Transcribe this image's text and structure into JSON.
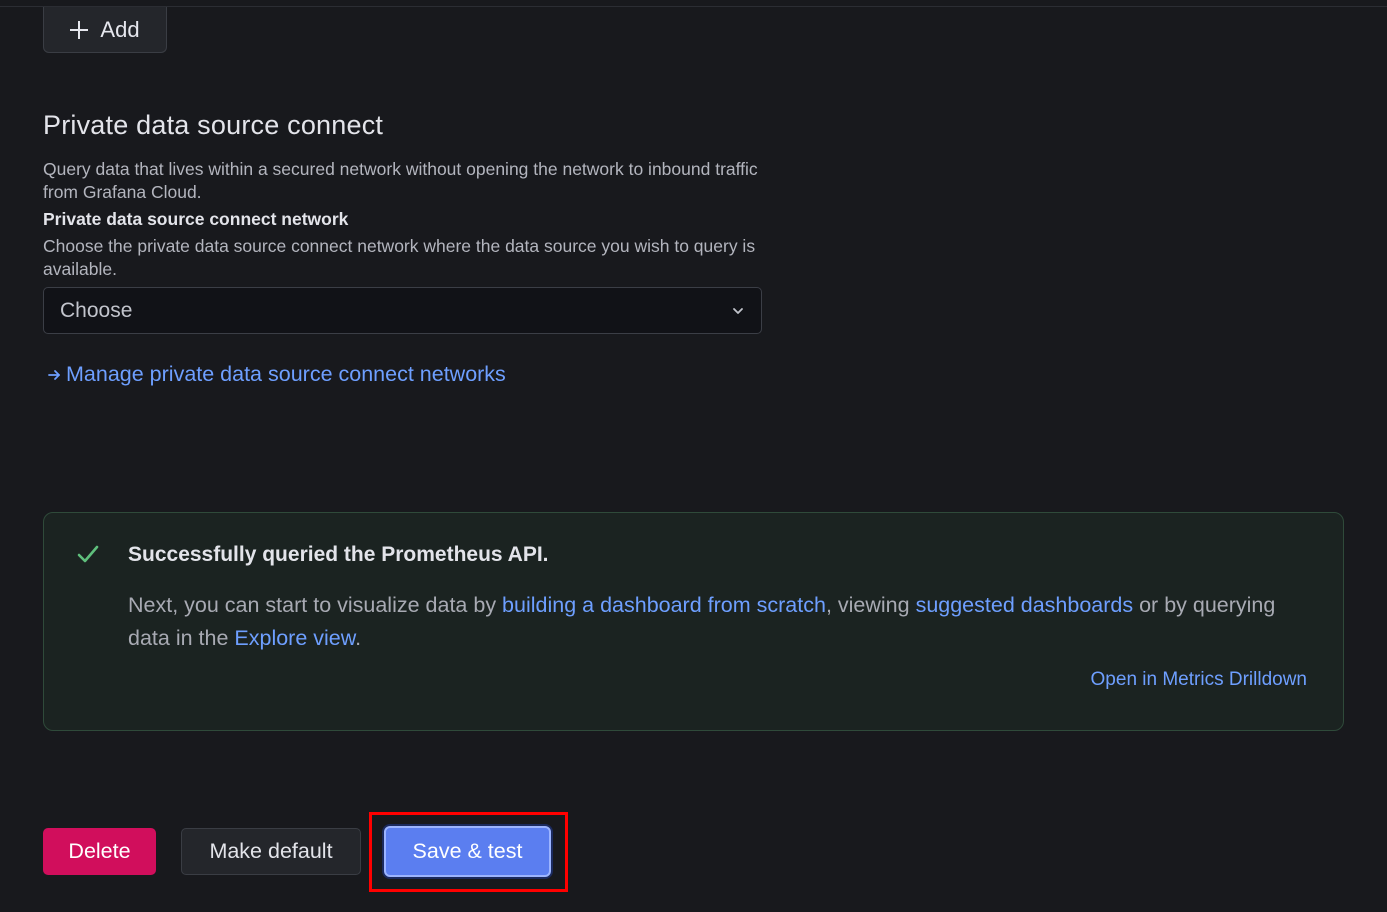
{
  "toolbar": {
    "add_label": "Add",
    "add_icon": "plus-icon"
  },
  "pdc": {
    "title": "Private data source connect",
    "description": "Query data that lives within a secured network without opening the network to inbound traffic from Grafana Cloud.",
    "network_label": "Private data source connect network",
    "network_description": "Choose the private data source connect network where the data source you wish to query is available.",
    "network_select": {
      "value": "Choose",
      "icon": "chevron-down-icon"
    },
    "manage_link": "Manage private data source connect networks"
  },
  "alert": {
    "status": "success",
    "title": "Successfully queried the Prometheus API.",
    "body_part1": "Next, you can start to visualize data by ",
    "link_dashboard": "building a dashboard from scratch",
    "body_part2": ", viewing ",
    "link_suggested": "suggested dashboards",
    "body_part3": " or by querying data in the ",
    "link_explore": "Explore view",
    "body_part4": ".",
    "metrics_link": "Open in Metrics Drilldown"
  },
  "actions": {
    "delete": "Delete",
    "make_default": "Make default",
    "save_test": "Save & test"
  },
  "colors": {
    "background": "#18191d",
    "link": "#6e9fff",
    "success": "#5fbf7c",
    "danger": "#d10e5c",
    "primary": "#5b7ef0",
    "highlight": "#ff0000"
  }
}
